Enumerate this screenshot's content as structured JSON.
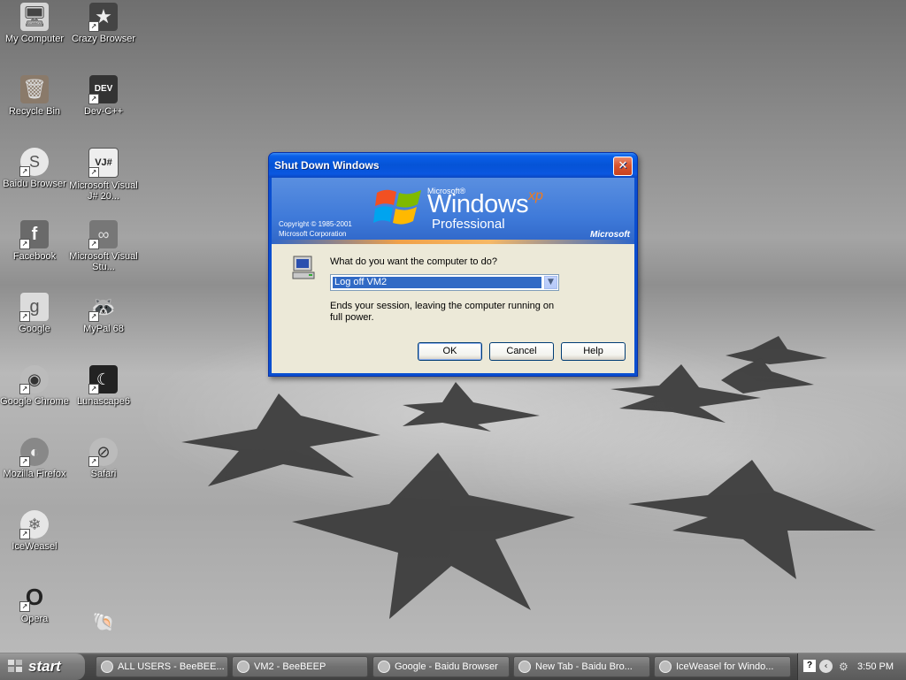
{
  "desktop": {
    "icons_left": [
      {
        "label": "My Computer",
        "icon": "my-computer-icon"
      },
      {
        "label": "Recycle Bin",
        "icon": "recycle-bin-icon"
      },
      {
        "label": "Baidu Browser",
        "icon": "baidu-browser-icon"
      },
      {
        "label": "Facebook",
        "icon": "facebook-icon"
      },
      {
        "label": "Google",
        "icon": "google-icon"
      },
      {
        "label": "Google Chrome",
        "icon": "chrome-icon"
      },
      {
        "label": "Mozilla Firefox",
        "icon": "firefox-icon"
      },
      {
        "label": "IceWeasel",
        "icon": "iceweasel-icon"
      },
      {
        "label": "Opera",
        "icon": "opera-icon"
      }
    ],
    "icons_right": [
      {
        "label": "Crazy Browser",
        "icon": "crazy-browser-icon"
      },
      {
        "label": "Dev-C++",
        "icon": "devcpp-icon"
      },
      {
        "label": "Microsoft Visual J# 20...",
        "icon": "visual-jsharp-icon"
      },
      {
        "label": "Microsoft Visual Stu...",
        "icon": "visual-studio-icon"
      },
      {
        "label": "MyPal 68",
        "icon": "mypal-icon"
      },
      {
        "label": "Lunascape6",
        "icon": "lunascape-icon"
      },
      {
        "label": "Safari",
        "icon": "safari-icon"
      },
      {
        "label": "",
        "icon": "shell-icon"
      }
    ]
  },
  "dialog": {
    "title": "Shut Down Windows",
    "banner": {
      "copyright_line1": "Copyright © 1985-2001",
      "copyright_line2": "Microsoft Corporation",
      "microsoft_small": "Microsoft®",
      "windows": "Windows",
      "xp": "xp",
      "edition": "Professional",
      "microsoft_logo": "Microsoft"
    },
    "prompt": "What do you want the computer to do?",
    "selected_option": "Log off VM2",
    "description": "Ends your session, leaving the computer running on full power.",
    "buttons": {
      "ok": "OK",
      "cancel": "Cancel",
      "help": "Help"
    }
  },
  "taskbar": {
    "start_label": "start",
    "tasks": [
      "ALL USERS - BeeBEE...",
      "VM2 - BeeBEEP",
      "Google - Baidu Browser",
      "New Tab - Baidu Bro...",
      "IceWeasel for Windo..."
    ],
    "clock": "3:50 PM"
  },
  "colors": {
    "titlebar_blue": "#0553d6",
    "dialog_face": "#ece9d8",
    "selection_blue": "#316ac5",
    "close_red": "#d9542e",
    "xp_orange": "#f07a1c"
  }
}
